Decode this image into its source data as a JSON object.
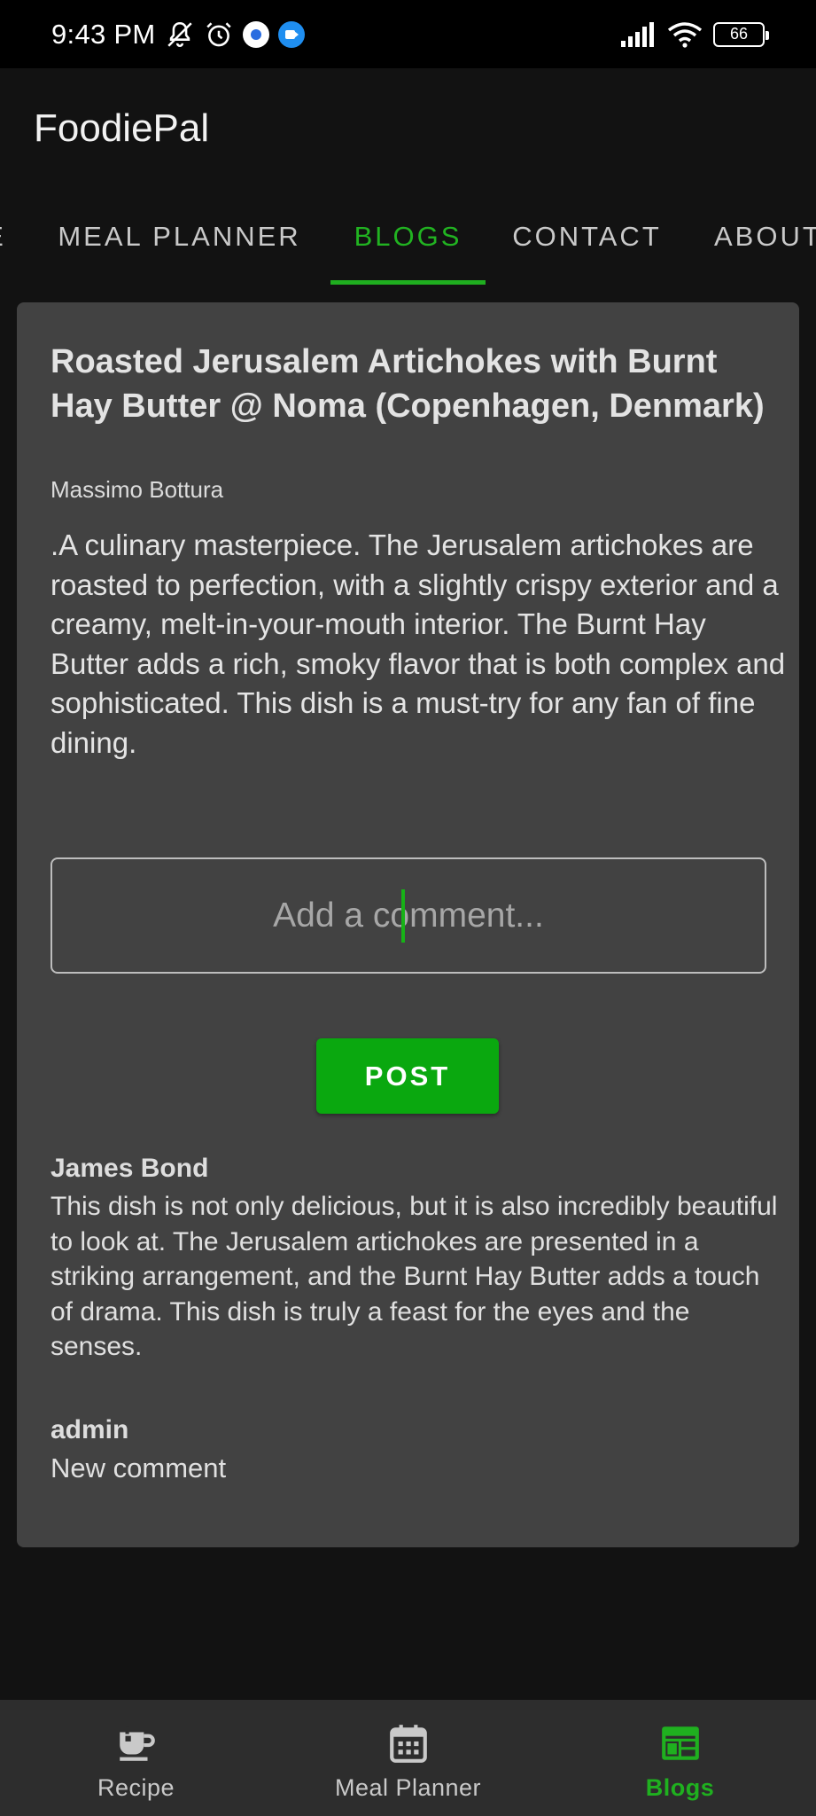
{
  "status_bar": {
    "time": "9:43 PM",
    "battery": "66"
  },
  "app": {
    "title": "FoodiePal"
  },
  "tabs": [
    {
      "label": "E"
    },
    {
      "label": "MEAL PLANNER"
    },
    {
      "label": "BLOGS",
      "active": true
    },
    {
      "label": "CONTACT"
    },
    {
      "label": "ABOUT"
    }
  ],
  "post": {
    "title": "Roasted Jerusalem Artichokes with Burnt Hay Butter @ Noma (Copenhagen, Denmark)",
    "author": "Massimo Bottura",
    "body": " .A culinary masterpiece. The Jerusalem artichokes are roasted to perfection, with a slightly crispy exterior and a creamy, melt-in-your-mouth interior. The Burnt Hay Butter adds a rich, smoky flavor that is both complex and sophisticated. This dish is a must-try for any fan of fine dining."
  },
  "comment_form": {
    "placeholder": "Add a comment...",
    "value": "",
    "post_label": "POST"
  },
  "comments": [
    {
      "user": "James Bond",
      "text": "This dish is not only delicious, but it is also incredibly beautiful to look at. The Jerusalem artichokes are presented in a striking arrangement, and the Burnt Hay Butter adds a touch of drama. This dish is truly a feast for the eyes and the senses."
    },
    {
      "user": "admin",
      "text": "New comment"
    }
  ],
  "bottom_nav": [
    {
      "label": "Recipe",
      "icon": "coffee-cup-icon"
    },
    {
      "label": "Meal Planner",
      "icon": "calendar-icon"
    },
    {
      "label": "Blogs",
      "icon": "blog-icon",
      "active": true
    }
  ],
  "colors": {
    "accent": "#1fae1f",
    "button": "#0aa80f",
    "card": "#424242",
    "background": "#121212",
    "bottom_nav": "#2d2d2d"
  }
}
